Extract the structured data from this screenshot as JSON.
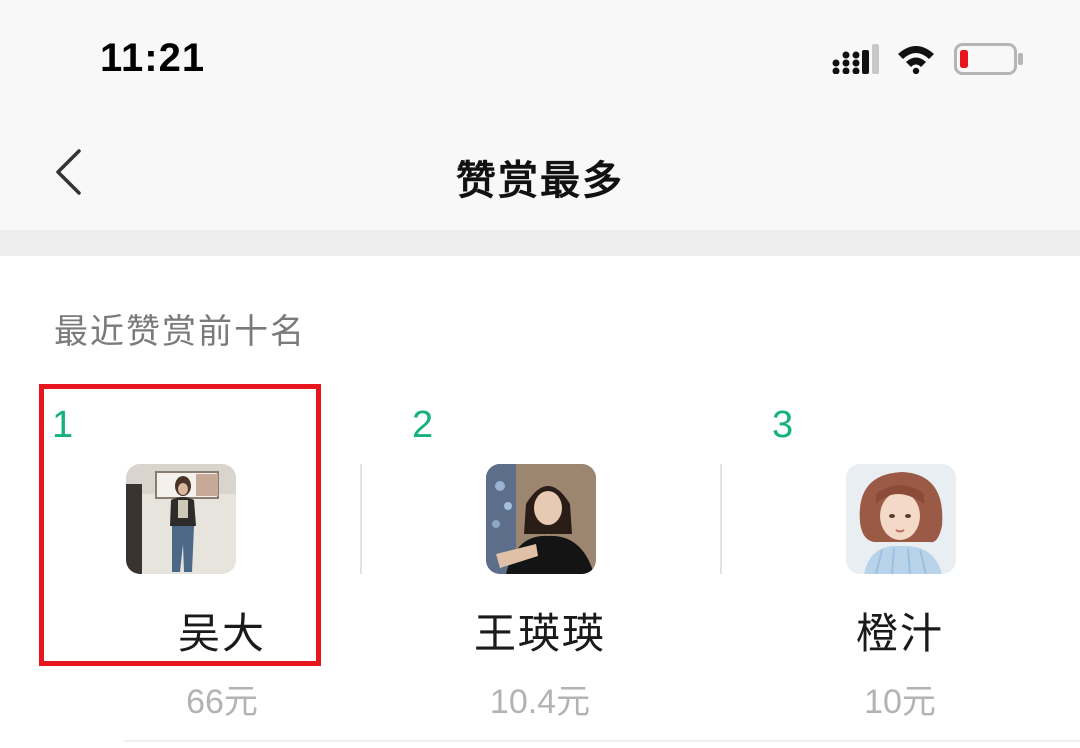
{
  "status_bar": {
    "time": "11:21",
    "icons": [
      "signal-icon",
      "wifi-icon",
      "battery-low-icon"
    ],
    "battery_color": "#e8141e"
  },
  "nav": {
    "back_icon": "chevron-left-icon",
    "title": "赞赏最多"
  },
  "section": {
    "title": "最近赞赏前十名"
  },
  "ranking": [
    {
      "rank": "1",
      "name": "吴大",
      "amount": "66元",
      "avatar": "avatar-woman-standing"
    },
    {
      "rank": "2",
      "name": "王瑛瑛",
      "amount": "10.4元",
      "avatar": "avatar-woman-black-jacket"
    },
    {
      "rank": "3",
      "name": "橙汁",
      "amount": "10元",
      "avatar": "avatar-illustrated-girl"
    }
  ],
  "colors": {
    "rank_green": "#16b27a",
    "highlight_red": "#e8141e",
    "amount_gray": "#b3b3b3"
  }
}
